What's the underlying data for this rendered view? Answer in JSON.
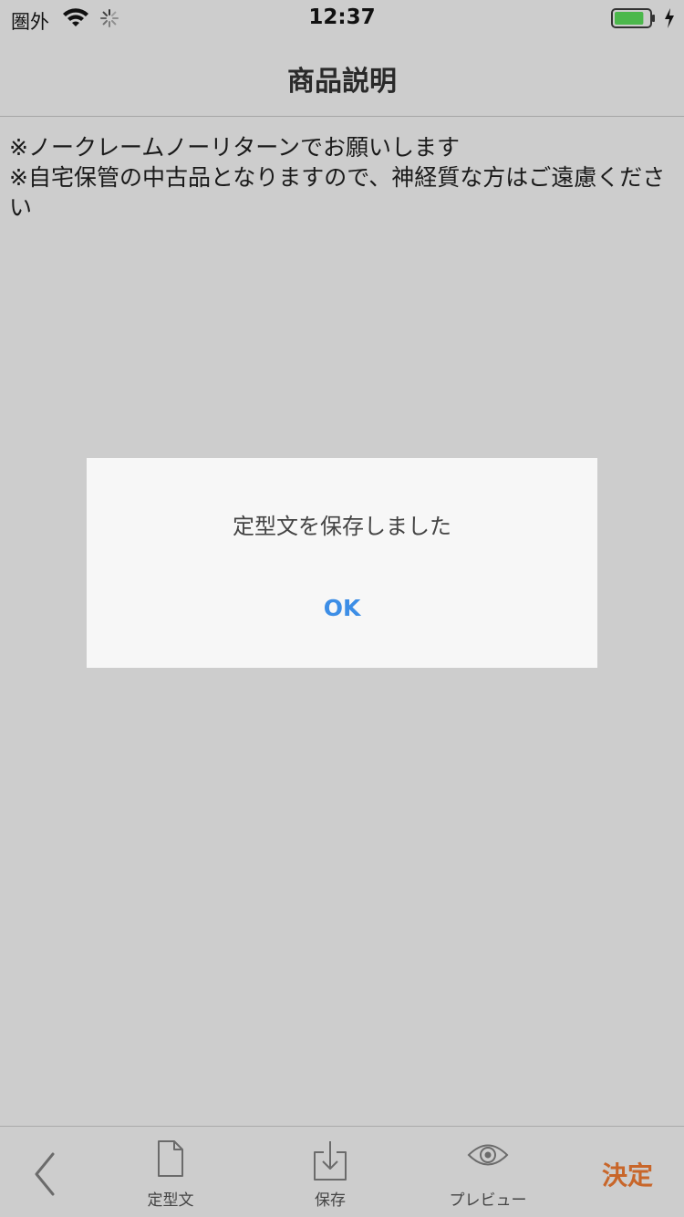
{
  "status_bar": {
    "carrier": "圏外",
    "time": "12:37",
    "icons": [
      "wifi-icon",
      "spinner-icon",
      "battery-icon",
      "charging-bolt-icon"
    ],
    "battery_level": 0.85
  },
  "nav": {
    "title": "商品説明"
  },
  "description": {
    "lines": [
      "※ノークレームノーリターンでお願いします",
      "※自宅保管の中古品となりますので、神経質な方はご遠慮ください"
    ]
  },
  "dialog": {
    "message": "定型文を保存しました",
    "ok_label": "OK"
  },
  "toolbar": {
    "back_icon": "chevron-left-icon",
    "template": {
      "label": "定型文",
      "icon": "document-icon"
    },
    "save": {
      "label": "保存",
      "icon": "download-icon"
    },
    "preview": {
      "label": "プレビュー",
      "icon": "eye-icon"
    },
    "decide_label": "決定"
  },
  "colors": {
    "background": "#cdcdcd",
    "dialog_bg": "#f7f7f7",
    "ok_blue": "#3d8ee6",
    "decide_orange": "#c8662a",
    "battery_green": "#4cb84c"
  }
}
